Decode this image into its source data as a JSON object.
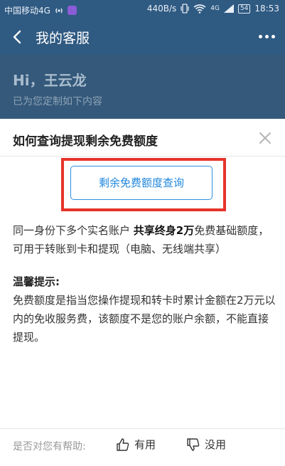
{
  "status_bar": {
    "carrier": "中国移动4G",
    "speed": "440B/s",
    "network": "4G",
    "battery": "54",
    "time": "18:53"
  },
  "nav": {
    "title": "我的客服"
  },
  "greeting": {
    "name": "Hi，王云龙",
    "subtitle": "已为您定制如下内容"
  },
  "sheet": {
    "title": "如何查询提现剩余免费额度",
    "query_button": "剩余免费额度查询",
    "para1_pre": "同一身份下多个实名账户",
    "para1_bold": "共享终身2万",
    "para1_post": "免费基础额度，可用于转账到卡和提现（电脑、无线端共享）",
    "tip_title": "温馨提示:",
    "tip_body": "免费额度是指当您操作提现和转卡时累计金额在2万元以内的免收服务费，该额度不是您的账户余额，不能直接提现。"
  },
  "feedback": {
    "question": "是否对您有帮助:",
    "yes_label": "有用",
    "no_label": "没用"
  },
  "colors": {
    "header_bg": "#2f5a82",
    "accent_blue": "#1e86dc",
    "highlight_red": "#e6332a"
  }
}
